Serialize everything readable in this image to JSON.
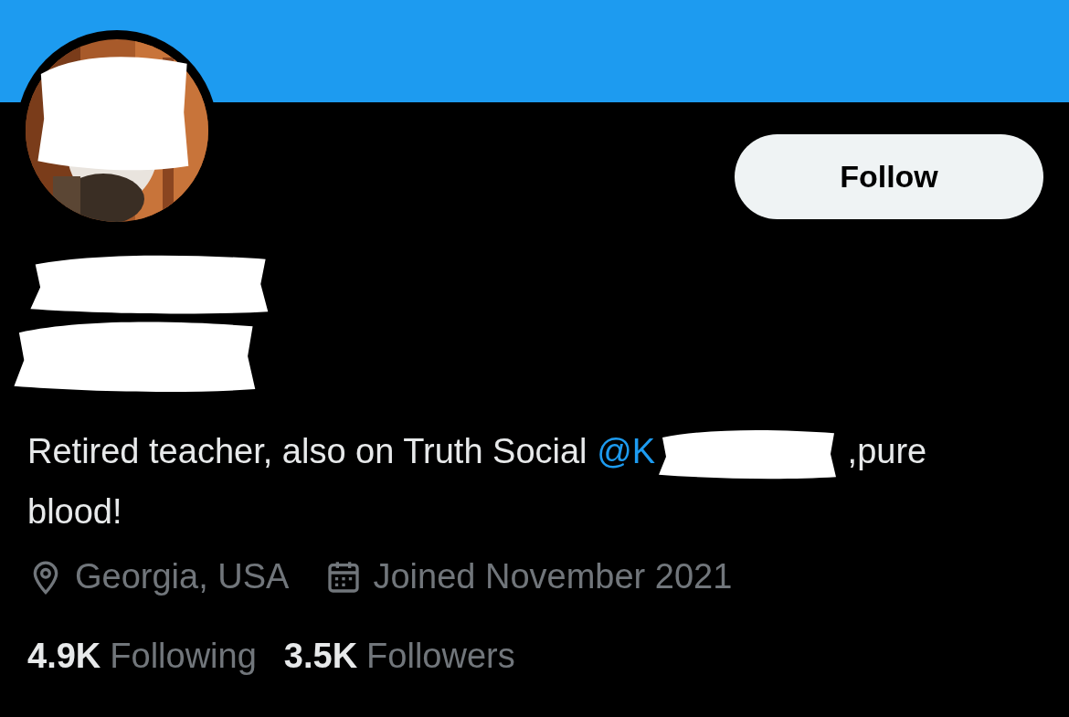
{
  "profile": {
    "avatar": {
      "kind": "picture",
      "redacted": true
    },
    "follow_button": "Follow",
    "display_name": {
      "redacted": true
    },
    "handle": {
      "redacted": true
    },
    "bio": {
      "before": "Retired teacher, also on Truth Social ",
      "mention": "@K",
      "mention_redacted": true,
      "after": " ,pure blood!"
    },
    "location": "Georgia, USA",
    "joined": "Joined November 2021",
    "stats": [
      {
        "count": "4.9K",
        "label": "Following"
      },
      {
        "count": "3.5K",
        "label": "Followers"
      }
    ]
  }
}
